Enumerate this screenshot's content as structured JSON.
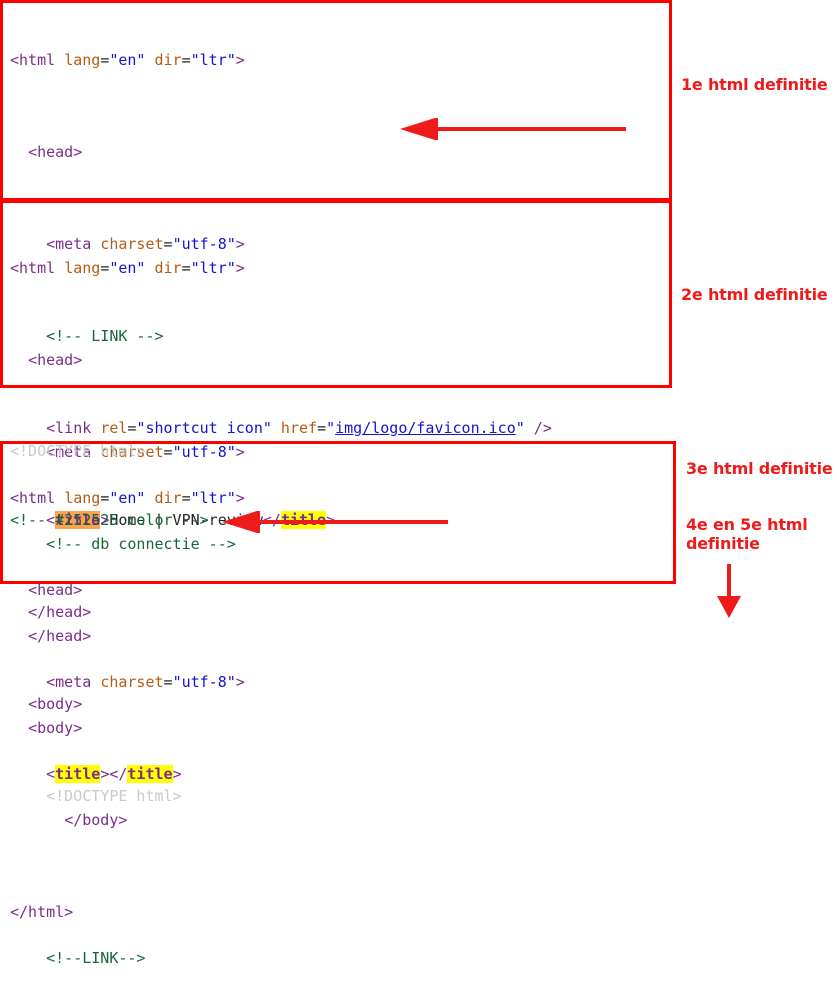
{
  "colors": {
    "box_border": "#fd0000",
    "arrow": "#ee1b1b",
    "note_text": "#ee1b1b",
    "highlight_yellow": "#ffff00",
    "highlight_orange": "#ffa24d",
    "tag": "#7b2d8b",
    "attribute": "#b35c17",
    "value": "#1414cc",
    "comment": "#17663a",
    "doctype_grey": "#c9c9c9",
    "plain_text": "#252525"
  },
  "block1": {
    "l1_tag_open": "<html ",
    "l1_attr1": "lang",
    "l1_eq1": "=",
    "l1_val1": "\"en\"",
    "l1_attr2": " dir",
    "l1_eq2": "=",
    "l1_val2": "\"ltr\"",
    "l1_tag_close": ">",
    "l2": "<head>",
    "l3_tag_open": "<meta ",
    "l3_attr": "charset",
    "l3_eq": "=",
    "l3_val": "\"utf-8\"",
    "l3_tag_close": ">",
    "l4_comment": "<!-- LINK -->",
    "l5_tag_open": "<link ",
    "l5_attr1": "rel",
    "l5_eq1": "=",
    "l5_val1": "\"shortcut icon\"",
    "l5_attr2": " href",
    "l5_eq2": "=",
    "l5_quote_open": "\"",
    "l5_href": "img/logo/favicon.ico",
    "l5_quote_close": "\"",
    "l5_tag_close": " />",
    "l6_lt": "<",
    "l6_title_open": "title",
    "l6_gt": ">",
    "l6_text": "Home | VPN-review",
    "l6_lt_close": "</",
    "l6_title_close": "title",
    "l6_gt_close": ">",
    "l7": "</head>",
    "l8": "<body>",
    "l9_doctype": "<!DOCTYPE html>"
  },
  "block2": {
    "l1_tag_open": "<html ",
    "l1_attr1": "lang",
    "l1_eq1": "=",
    "l1_val1": "\"en\"",
    "l1_attr2": " dir",
    "l1_eq2": "=",
    "l1_val2": "\"ltr\"",
    "l1_tag_close": ">",
    "l2": "<head>",
    "l3_tag_open": "<meta ",
    "l3_attr": "charset",
    "l3_eq": "=",
    "l3_val": "\"utf-8\"",
    "l3_tag_close": ">",
    "l4_comment": "<!-- db connectie -->",
    "l5": "</head>",
    "l6": "<body>",
    "l7": "</body>",
    "l8": "</html>"
  },
  "between": {
    "doctype": "<!DOCTYPE html>",
    "comment": "<!-- #252525 color -->"
  },
  "block3": {
    "l1_tag_open": "<html ",
    "l1_attr1": "lang",
    "l1_eq1": "=",
    "l1_val1": "\"en\"",
    "l1_attr2": " dir",
    "l1_eq2": "=",
    "l1_val2": "\"ltr\"",
    "l1_tag_close": ">",
    "l2": "<head>",
    "l3_tag_open": "<meta ",
    "l3_attr": "charset",
    "l3_eq": "=",
    "l3_val": "\"utf-8\"",
    "l3_tag_close": ">",
    "l4_lt": "<",
    "l4_title_open": "title",
    "l4_gt": ">",
    "l4_lt_close": "</",
    "l4_title_close": "title",
    "l4_gt_close": ">",
    "l5_comment": "<!--LINK-->"
  },
  "annotations": {
    "note1": "1e html definitie",
    "note2": "2e html definitie",
    "note3": "3e html definitie",
    "note4_line1": "4e en 5e html",
    "note4_line2": "definitie"
  }
}
